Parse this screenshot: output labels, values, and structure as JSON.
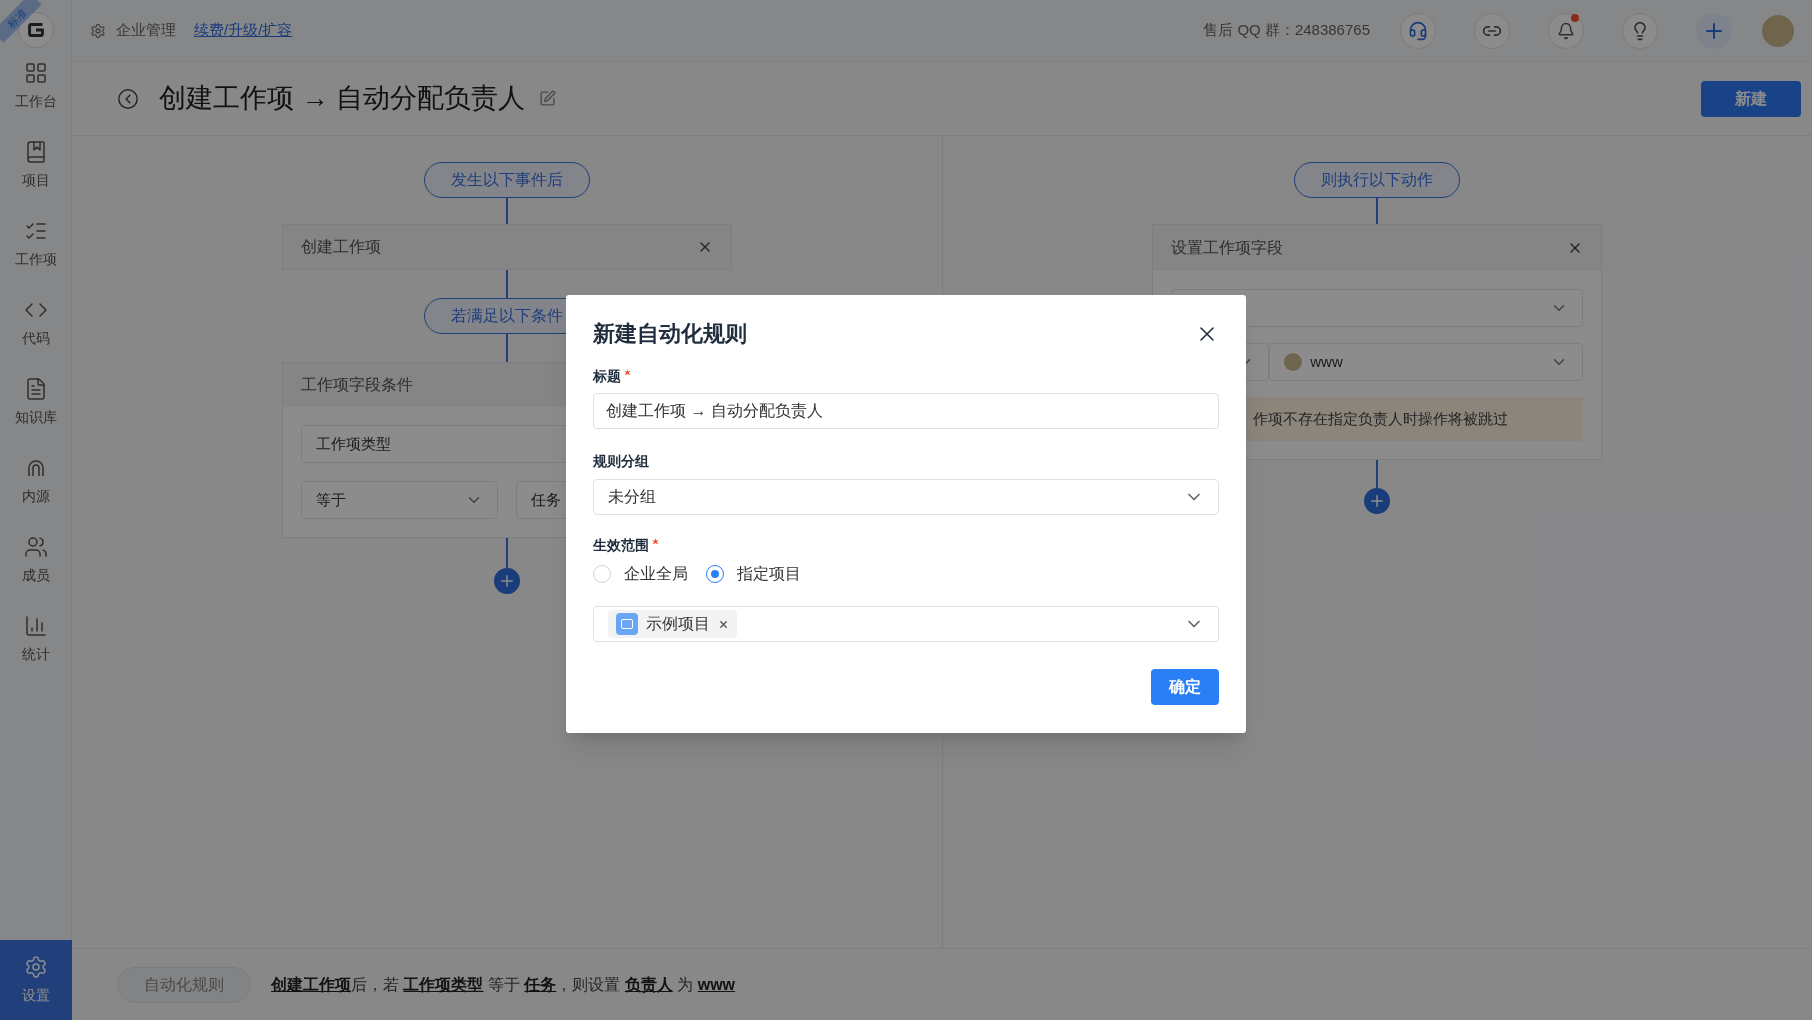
{
  "top_bar": {
    "badge": "标准",
    "enterprise": "企业管理",
    "upgrade_link": "续费/升级/扩容",
    "support": "售后 QQ 群：248386765",
    "notification_dot": true
  },
  "sidebar": {
    "items": [
      {
        "label": "工作台",
        "selected": false
      },
      {
        "label": "项目",
        "selected": false
      },
      {
        "label": "工作项",
        "selected": false
      },
      {
        "label": "代码",
        "selected": false
      },
      {
        "label": "知识库",
        "selected": false
      },
      {
        "label": "内源",
        "selected": false
      },
      {
        "label": "成员",
        "selected": false
      },
      {
        "label": "统计",
        "selected": false
      },
      {
        "label": "设置",
        "selected": true
      }
    ]
  },
  "header": {
    "title": "创建工作项 → 自动分配负责人",
    "new_button": "新建"
  },
  "trigger": {
    "pill": "发生以下事件后",
    "card": "创建工作项"
  },
  "condition": {
    "pill": "若满足以下条件",
    "card": "工作项字段条件",
    "field": "工作项类型",
    "operator": "等于",
    "value": "任务"
  },
  "action": {
    "pill": "则执行以下动作",
    "card": "设置工作项字段",
    "assignee": "www",
    "warning": "作项不存在指定负责人时操作将被跳过"
  },
  "footer": {
    "tab": "自动化规则",
    "summary": [
      {
        "text": "创建工作项",
        "link": true
      },
      {
        "text": "后，若 ",
        "link": false
      },
      {
        "text": "工作项类型",
        "link": true
      },
      {
        "text": " 等于 ",
        "link": false
      },
      {
        "text": "任务",
        "link": true
      },
      {
        "text": "，则设置 ",
        "link": false
      },
      {
        "text": "负责人",
        "link": true
      },
      {
        "text": " 为 ",
        "link": false
      },
      {
        "text": "www",
        "link": true
      }
    ]
  },
  "dialog": {
    "title": "新建自动化规则",
    "title_label": "标题",
    "title_required": true,
    "title_value": "创建工作项 → 自动分配负责人",
    "group_label": "规则分组",
    "group_value": "未分组",
    "scope_label": "生效范围",
    "scope_required": true,
    "scope_options": [
      {
        "label": "企业全局",
        "selected": false
      },
      {
        "label": "指定项目",
        "selected": true
      }
    ],
    "projects": [
      "示例项目"
    ],
    "confirm": "确定"
  }
}
